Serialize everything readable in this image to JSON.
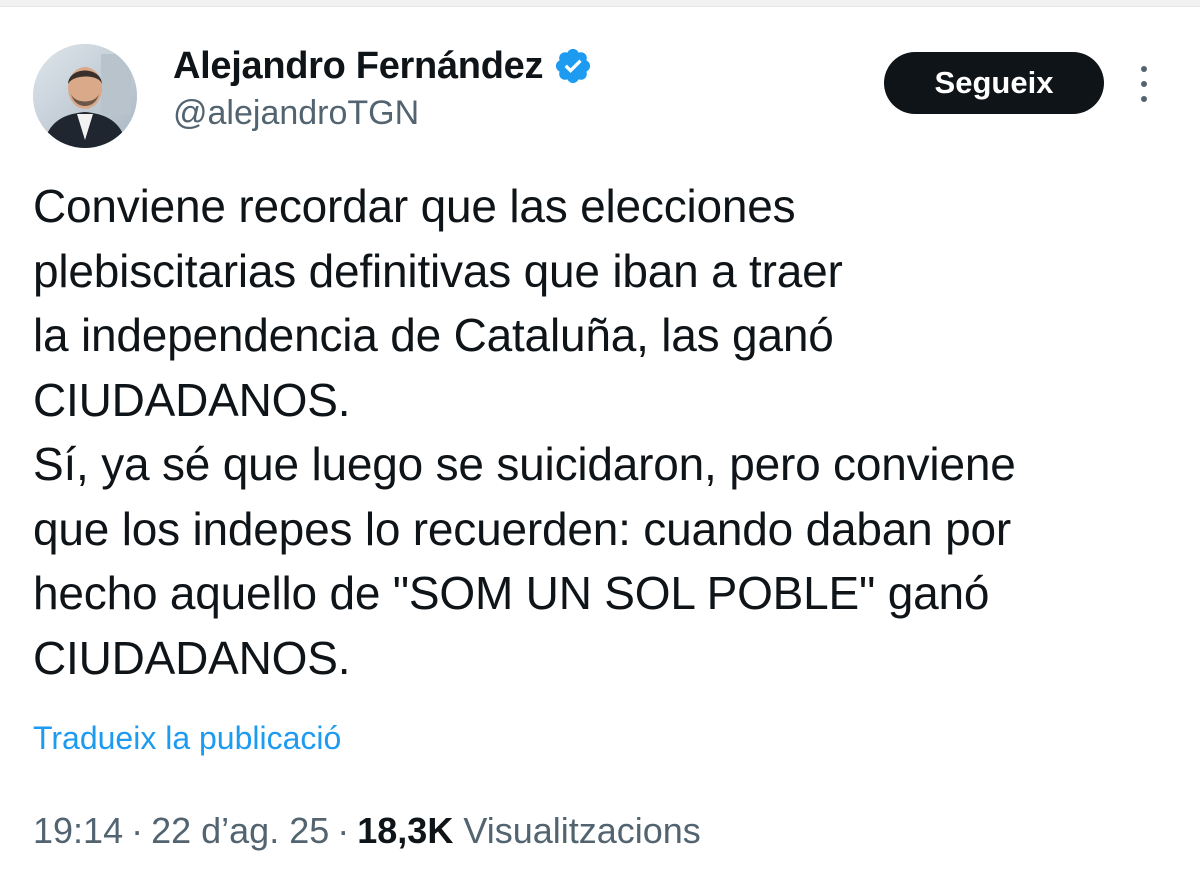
{
  "author": {
    "display_name": "Alejandro Fernández",
    "handle": "@alejandroTGN",
    "verified_badge_color": "#1d9bf0"
  },
  "follow_button": {
    "label": "Segueix",
    "background": "#0f1419"
  },
  "more_menu": {
    "icon": "more-vertical-icon"
  },
  "tweet": {
    "lines": [
      "Conviene recordar que las elecciones",
      "plebiscitarias definitivas que iban a traer",
      "la independencia de Cataluña, las ganó",
      "CIUDADANOS.",
      "Sí, ya sé que luego se suicidaron, pero conviene",
      "que los indepes lo recuerden: cuando daban por",
      "hecho aquello de \"SOM UN SOL POBLE\" ganó",
      "CIUDADANOS."
    ]
  },
  "translate": {
    "label": "Tradueix la publicació",
    "color": "#1d9bf0"
  },
  "meta": {
    "time": "19:14",
    "separator": "·",
    "date": "22 d’ag. 25",
    "views_count": "18,3K",
    "views_label": "Visualitzacions"
  }
}
